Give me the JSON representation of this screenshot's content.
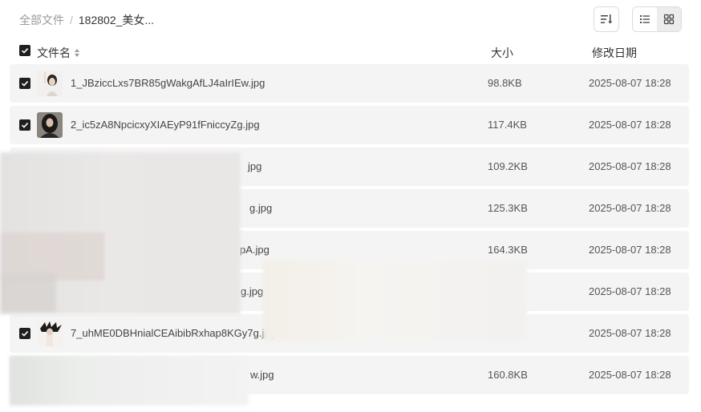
{
  "breadcrumb": {
    "root": "全部文件",
    "separator": "/",
    "current": "182802_美女..."
  },
  "toolbar": {
    "sort_icon": "sort-lines-icon",
    "list_view_icon": "list-view-icon",
    "grid_view_icon": "grid-view-icon",
    "active_view": "grid"
  },
  "table": {
    "columns": {
      "name": "文件名",
      "size": "大小",
      "date": "修改日期"
    },
    "rows": [
      {
        "name": "1_JBziccLxs7BR85gWakgAfLJ4aIrIEw.jpg",
        "size": "98.8KB",
        "date": "2025-08-07 18:28",
        "checked": true
      },
      {
        "name": "2_ic5zA8NpcicxyXIAEyP91fFniccyZg.jpg",
        "size": "117.4KB",
        "date": "2025-08-07 18:28",
        "checked": true
      },
      {
        "name": "jpg",
        "size": "109.2KB",
        "date": "2025-08-07 18:28",
        "checked": true
      },
      {
        "name": "g.jpg",
        "size": "125.3KB",
        "date": "2025-08-07 18:28",
        "checked": true
      },
      {
        "name": "pA.jpg",
        "size": "164.3KB",
        "date": "2025-08-07 18:28",
        "checked": true
      },
      {
        "name": "g.jpg",
        "size": "",
        "date": "2025-08-07 18:28",
        "checked": true
      },
      {
        "name": "7_uhME0DBHnialCEAibibRxhap8KGy7g.jpg",
        "size": "",
        "date": "2025-08-07 18:28",
        "checked": true
      },
      {
        "name": "w.jpg",
        "size": "160.8KB",
        "date": "2025-08-07 18:28",
        "checked": true
      }
    ]
  },
  "colors": {
    "row_bg": "#f4f4f4",
    "checkbox": "#1f1f1f",
    "obscured_overlay": "#e9e9e9"
  }
}
